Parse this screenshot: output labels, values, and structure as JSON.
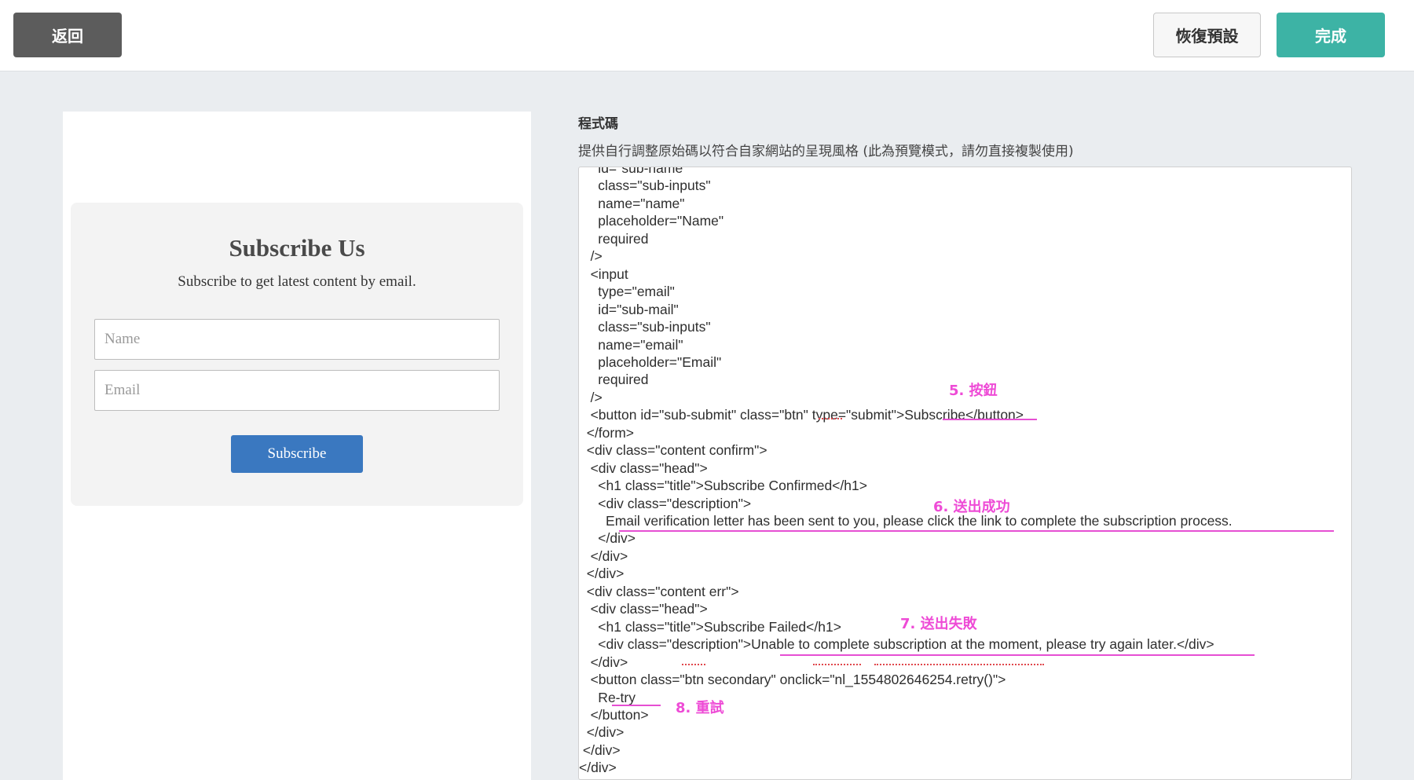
{
  "toolbar": {
    "back_label": "返回",
    "reset_label": "恢復預設",
    "done_label": "完成"
  },
  "preview": {
    "title": "Subscribe Us",
    "description": "Subscribe to get latest content by email.",
    "name_placeholder": "Name",
    "email_placeholder": "Email",
    "submit_label": "Subscribe"
  },
  "code": {
    "label": "程式碼",
    "hint": "提供自行調整原始碼以符合自家網站的呈現風格 (此為預覽模式，請勿直接複製使用)",
    "lines": [
      "     id=\"sub-name\"",
      "     class=\"sub-inputs\"",
      "     name=\"name\"",
      "     placeholder=\"Name\"",
      "     required",
      "   />",
      "   <input",
      "     type=\"email\"",
      "     id=\"sub-mail\"",
      "     class=\"sub-inputs\"",
      "     name=\"email\"",
      "     placeholder=\"Email\"",
      "     required",
      "   />",
      "   <button id=\"sub-submit\" class=\"btn\" type=\"submit\">Subscribe</button>",
      "  </form>",
      "  <div class=\"content confirm\">",
      "   <div class=\"head\">",
      "     <h1 class=\"title\">Subscribe Confirmed</h1>",
      "     <div class=\"description\">",
      "       Email verification letter has been sent to you, please click the link to complete the subscription process.",
      "     </div>",
      "   </div>",
      "  </div>",
      "  <div class=\"content err\">",
      "   <div class=\"head\">",
      "     <h1 class=\"title\">Subscribe Failed</h1>",
      "     <div class=\"description\">Unable to complete subscription at the moment, please try again later.</div>",
      "   </div>",
      "   <button class=\"btn secondary\" onclick=\"nl_1554802646254.retry()\">",
      "     Re-try",
      "   </button>",
      "  </div>",
      " </div>",
      "</div>"
    ]
  },
  "annotations": {
    "button": "5. 按鈕",
    "success": "6. 送出成功",
    "fail": "7. 送出失敗",
    "retry": "8. 重試"
  },
  "colors": {
    "annotation": "#ee4bd6",
    "done_button": "#3db3a5",
    "back_button": "#5c5c5c",
    "subscribe_button": "#3a78c0"
  }
}
